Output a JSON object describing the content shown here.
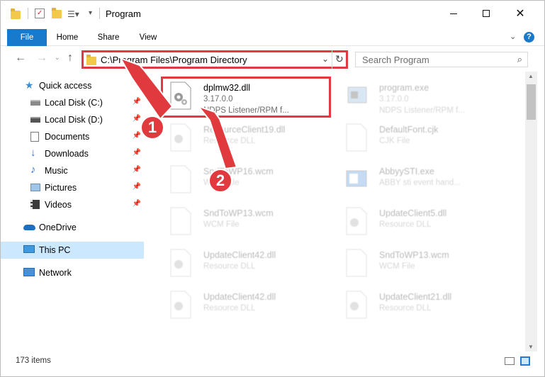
{
  "window": {
    "title": "Program"
  },
  "ribbon": {
    "tabs": [
      "File",
      "Home",
      "Share",
      "View"
    ]
  },
  "address": {
    "path": "C:\\Program Files\\Program Directory"
  },
  "search": {
    "placeholder": "Search Program"
  },
  "sidebar": {
    "items": [
      {
        "label": "Quick access",
        "icon": "star-icon",
        "pinned": false
      },
      {
        "label": "Local Disk (C:)",
        "icon": "drive-icon",
        "pinned": true
      },
      {
        "label": "Local Disk (D:)",
        "icon": "drive-icon",
        "pinned": true
      },
      {
        "label": "Documents",
        "icon": "documents-icon",
        "pinned": true
      },
      {
        "label": "Downloads",
        "icon": "download-icon",
        "pinned": true
      },
      {
        "label": "Music",
        "icon": "music-icon",
        "pinned": true
      },
      {
        "label": "Pictures",
        "icon": "pictures-icon",
        "pinned": true
      },
      {
        "label": "Videos",
        "icon": "videos-icon",
        "pinned": true
      },
      {
        "label": "OneDrive",
        "icon": "cloud-icon",
        "pinned": false
      },
      {
        "label": "This PC",
        "icon": "pc-icon",
        "pinned": false,
        "selected": true
      },
      {
        "label": "Network",
        "icon": "network-icon",
        "pinned": false
      }
    ]
  },
  "files": [
    {
      "name": "dplmw32.dll",
      "line1": "3.17.0.0",
      "line2": "NDPS Listener/RPM f...",
      "icon": "dll-gear-icon",
      "highlighted": true
    },
    {
      "name": "program.exe",
      "line1": "3.17.0.0",
      "line2": "NDPS Listener/RPM f...",
      "icon": "exe-icon"
    },
    {
      "name": "ResourceClient19.dll",
      "line1": "Resource DLL",
      "line2": "",
      "icon": "dll-gear-icon"
    },
    {
      "name": "DefaultFont.cjk",
      "line1": "CJK File",
      "line2": "",
      "icon": "file-icon"
    },
    {
      "name": "SndToWP16.wcm",
      "line1": "WCM File",
      "line2": "",
      "icon": "file-icon"
    },
    {
      "name": "AbbyySTI.exe",
      "line1": "ABBY sti event hand...",
      "line2": "",
      "icon": "exe-icon"
    },
    {
      "name": "SndToWP13.wcm",
      "line1": "WCM File",
      "line2": "",
      "icon": "file-icon"
    },
    {
      "name": "UpdateClient5.dll",
      "line1": "Resource DLL",
      "line2": "",
      "icon": "dll-gear-icon"
    },
    {
      "name": "UpdateClient42.dll",
      "line1": "Resource DLL",
      "line2": "",
      "icon": "dll-gear-icon"
    },
    {
      "name": "SndToWP13.wcm",
      "line1": "WCM File",
      "line2": "",
      "icon": "file-icon"
    },
    {
      "name": "UpdateClient42.dll",
      "line1": "Resource DLL",
      "line2": "",
      "icon": "dll-gear-icon"
    },
    {
      "name": "UpdateClient21.dll",
      "line1": "Resource DLL",
      "line2": "",
      "icon": "dll-gear-icon"
    }
  ],
  "status": {
    "items_count": "173 items"
  },
  "markers": {
    "one": "1",
    "two": "2"
  },
  "colors": {
    "accent": "#1979ca",
    "highlight": "#e0393e",
    "selection": "#cce8ff"
  }
}
